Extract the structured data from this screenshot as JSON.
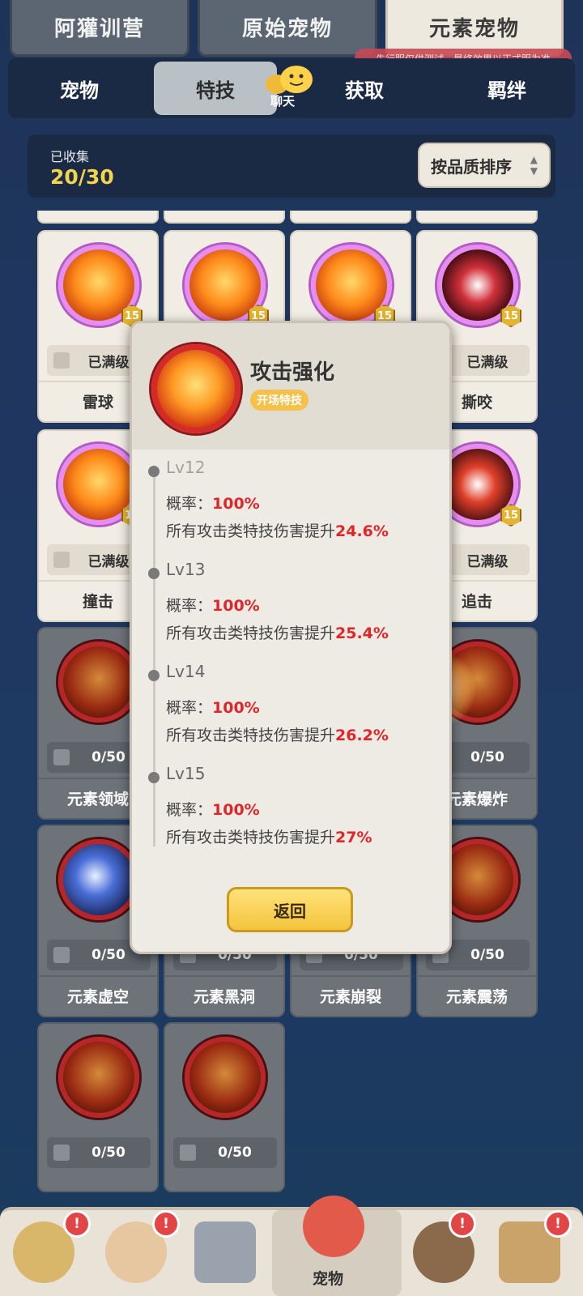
{
  "top_tabs": [
    "阿獾训营",
    "原始宠物",
    "元素宠物"
  ],
  "notice": "先行服仅供测试，最终效果以正式服为准",
  "sub_tabs": [
    "宠物",
    "特技",
    "获取",
    "羁绊"
  ],
  "chat_label": "聊天",
  "collection": {
    "label": "已收集",
    "count": "20/30"
  },
  "sort_button": "按品质排序",
  "cards": [
    {
      "name": "雷球",
      "status": "已满级",
      "level": "15",
      "locked": false
    },
    {
      "name": "",
      "status": "",
      "level": "15",
      "locked": false
    },
    {
      "name": "",
      "status": "",
      "level": "15",
      "locked": false
    },
    {
      "name": "撕咬",
      "status": "已满级",
      "level": "15",
      "locked": false
    },
    {
      "name": "撞击",
      "status": "已满级",
      "level": "15",
      "locked": false
    },
    {
      "name": "追击",
      "status": "已满级",
      "level": "15",
      "locked": false
    },
    {
      "name": "元素领域",
      "status": "0/50",
      "locked": true
    },
    {
      "name": "元素爆炸",
      "status": "0/50",
      "locked": true
    },
    {
      "name": "元素虚空",
      "status": "0/50",
      "locked": true
    },
    {
      "name": "元素黑洞",
      "status": "0/50",
      "locked": true
    },
    {
      "name": "元素崩裂",
      "status": "0/50",
      "locked": true
    },
    {
      "name": "元素震荡",
      "status": "0/50",
      "locked": true
    },
    {
      "name": "",
      "status": "0/50",
      "locked": true
    },
    {
      "name": "",
      "status": "0/50",
      "locked": true
    }
  ],
  "modal": {
    "title": "攻击强化",
    "tag": "开场特技",
    "rate_label": "概率：",
    "effect_label": "所有攻击类特技伤害提升",
    "levels": [
      {
        "name": "Lv12",
        "rate": "100%",
        "effect": "24.6%"
      },
      {
        "name": "Lv13",
        "rate": "100%",
        "effect": "25.4%"
      },
      {
        "name": "Lv14",
        "rate": "100%",
        "effect": "26.2%"
      },
      {
        "name": "Lv15",
        "rate": "100%",
        "effect": "27%"
      }
    ],
    "back_button": "返回"
  },
  "bottom_nav": {
    "active_label": "宠物",
    "alert": "!"
  }
}
